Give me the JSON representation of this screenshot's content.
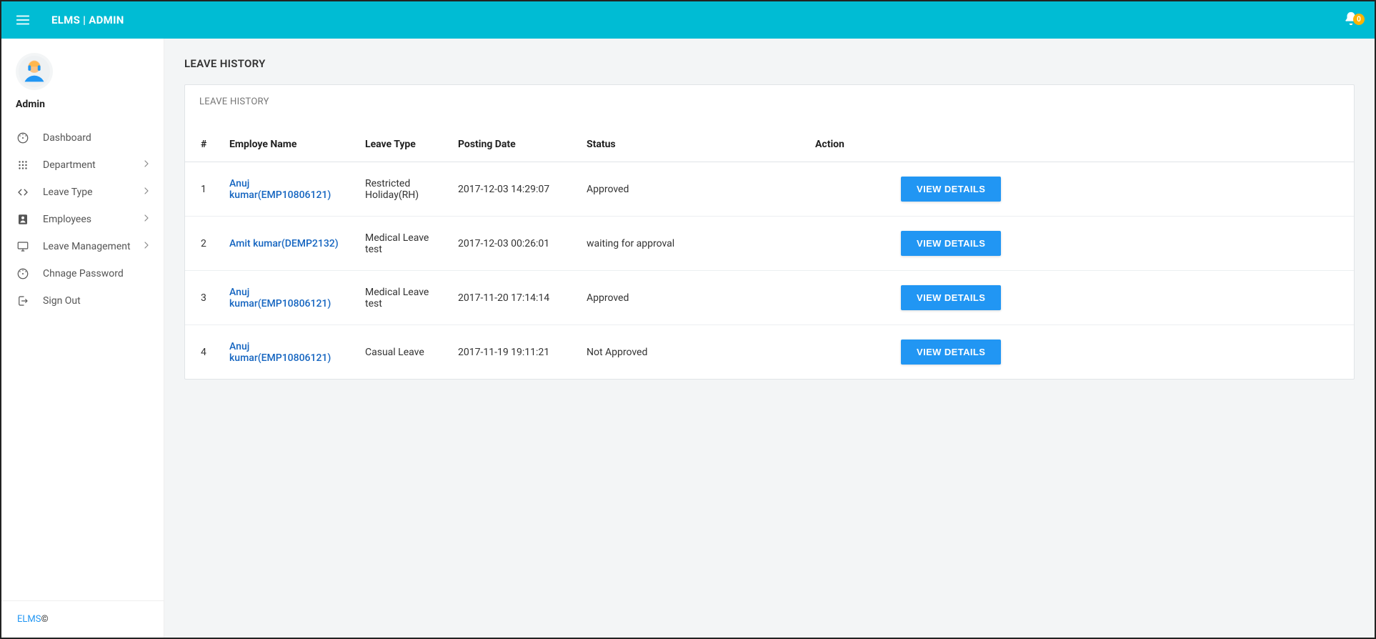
{
  "header": {
    "brand": "ELMS | ADMIN",
    "notification_count": "0"
  },
  "sidebar": {
    "profile_name": "Admin",
    "items": [
      {
        "label": "Dashboard",
        "icon": "dashboard-icon",
        "expandable": false
      },
      {
        "label": "Department",
        "icon": "grid-icon",
        "expandable": true
      },
      {
        "label": "Leave Type",
        "icon": "code-icon",
        "expandable": true
      },
      {
        "label": "Employees",
        "icon": "account-icon",
        "expandable": true
      },
      {
        "label": "Leave Management",
        "icon": "monitor-icon",
        "expandable": true
      },
      {
        "label": "Chnage Password",
        "icon": "dashboard-icon",
        "expandable": false
      },
      {
        "label": "Sign Out",
        "icon": "signout-icon",
        "expandable": false
      }
    ],
    "footer_brand": "ELMS",
    "footer_copy": "©"
  },
  "main": {
    "page_title": "LEAVE HISTORY",
    "card_title": "LEAVE HISTORY",
    "columns": {
      "idx": "#",
      "employee": "Employe Name",
      "leave_type": "Leave Type",
      "posting_date": "Posting Date",
      "status": "Status",
      "action": "Action"
    },
    "view_button_label": "VIEW DETAILS",
    "rows": [
      {
        "idx": "1",
        "employee": "Anuj kumar(EMP10806121)",
        "leave_type": "Restricted Holiday(RH)",
        "posting_date": "2017-12-03 14:29:07",
        "status": "Approved",
        "status_class": "status-approved"
      },
      {
        "idx": "2",
        "employee": "Amit kumar(DEMP2132)",
        "leave_type": "Medical Leave test",
        "posting_date": "2017-12-03 00:26:01",
        "status": "waiting for approval",
        "status_class": "status-waiting"
      },
      {
        "idx": "3",
        "employee": "Anuj kumar(EMP10806121)",
        "leave_type": "Medical Leave test",
        "posting_date": "2017-11-20 17:14:14",
        "status": "Approved",
        "status_class": "status-approved"
      },
      {
        "idx": "4",
        "employee": "Anuj kumar(EMP10806121)",
        "leave_type": "Casual Leave",
        "posting_date": "2017-11-19 19:11:21",
        "status": "Not Approved",
        "status_class": "status-rejected"
      }
    ]
  }
}
